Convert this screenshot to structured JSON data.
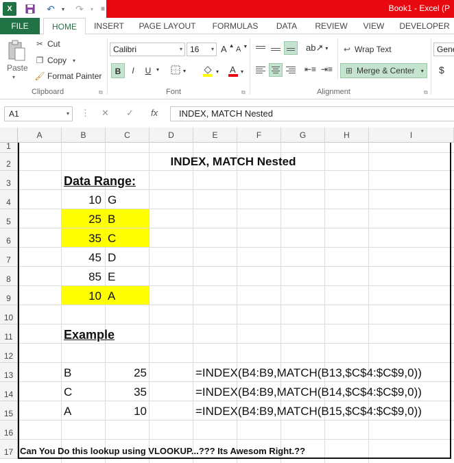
{
  "window": {
    "title": "Book1 - Excel (P"
  },
  "tabs": [
    "FILE",
    "HOME",
    "INSERT",
    "PAGE LAYOUT",
    "FORMULAS",
    "DATA",
    "REVIEW",
    "VIEW",
    "DEVELOPER"
  ],
  "clipboard": {
    "paste": "Paste",
    "cut": "Cut",
    "copy": "Copy",
    "format_painter": "Format Painter",
    "label": "Clipboard"
  },
  "font": {
    "name": "Calibri",
    "size": "16",
    "grow": "A",
    "shrink": "A",
    "bold": "B",
    "italic": "I",
    "underline": "U",
    "label": "Font"
  },
  "alignment": {
    "wrap_text": "Wrap Text",
    "merge_center": "Merge & Center",
    "label": "Alignment"
  },
  "number": {
    "format": "Gene",
    "currency": "$"
  },
  "formula_bar": {
    "name_box": "A1",
    "formula": "INDEX, MATCH Nested",
    "fx": "fx"
  },
  "columns": [
    "A",
    "B",
    "C",
    "D",
    "E",
    "F",
    "G",
    "H",
    "I"
  ],
  "rows": [
    "1",
    "2",
    "3",
    "4",
    "5",
    "6",
    "7",
    "8",
    "9",
    "10",
    "11",
    "12",
    "13",
    "14",
    "15",
    "16",
    "17"
  ],
  "sheet": {
    "title": "INDEX, MATCH Nested",
    "data_range_heading": "Data Range:",
    "data_range": [
      {
        "num": "10",
        "letter": "G"
      },
      {
        "num": "25",
        "letter": "B"
      },
      {
        "num": "35",
        "letter": "C"
      },
      {
        "num": "45",
        "letter": "D"
      },
      {
        "num": "85",
        "letter": "E"
      },
      {
        "num": "10",
        "letter": "A"
      }
    ],
    "example_heading": "Example",
    "examples": [
      {
        "key": "B",
        "value": "25",
        "formula": "=INDEX(B4:B9,MATCH(B13,$C$4:$C$9,0))"
      },
      {
        "key": "C",
        "value": "35",
        "formula": "=INDEX(B4:B9,MATCH(B14,$C$4:$C$9,0))"
      },
      {
        "key": "A",
        "value": "10",
        "formula": "=INDEX(B4:B9,MATCH(B15,$C$4:$C$9,0))"
      }
    ],
    "footer": "Can You Do this lookup using VLOOKUP...???  Its Awesom Right.??",
    "highlight_color": "#ffff00"
  },
  "colors": {
    "excel_green": "#217346",
    "title_red": "#e8080f"
  }
}
